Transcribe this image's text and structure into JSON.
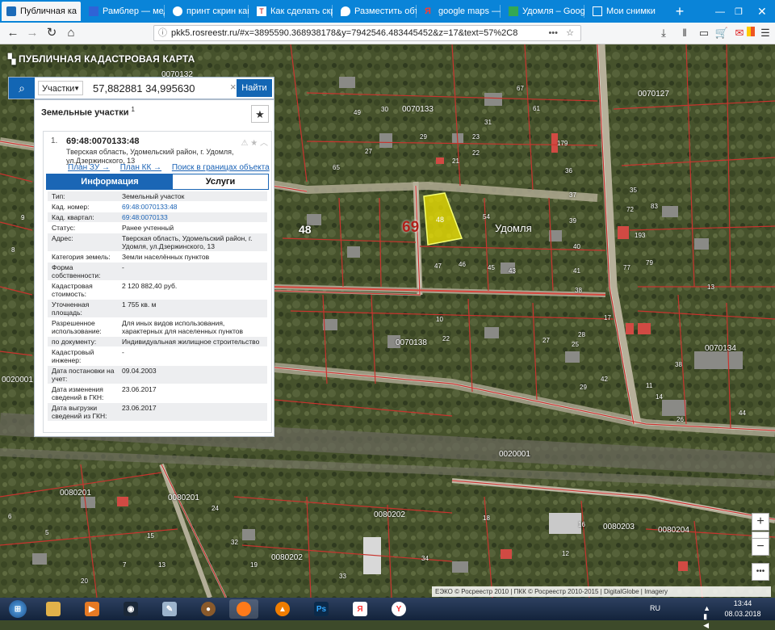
{
  "browser": {
    "tabs": [
      {
        "title": "Публичная ка",
        "active": true,
        "icon": "rosreestr-icon"
      },
      {
        "title": "Рамблер — меди",
        "icon": "rambler-icon"
      },
      {
        "title": "принт скрин как",
        "icon": "print-icon"
      },
      {
        "title": "Как сделать скри",
        "icon": "article-icon"
      },
      {
        "title": "Разместить объя",
        "icon": "map-pin-icon"
      },
      {
        "title": "google maps — Я",
        "icon": "yandex-icon"
      },
      {
        "title": "Удомля – Google",
        "icon": "google-maps-icon"
      },
      {
        "title": "Мои снимки",
        "icon": "screenshots-icon"
      }
    ],
    "url": "pkk5.rosreestr.ru/#x=3895590.368938178&y=7942546.483445452&z=17&text=57%2C8"
  },
  "app": {
    "brand": "ПУБЛИЧНАЯ КАДАСТРОВАЯ КАРТА"
  },
  "search": {
    "type_label": "Участки",
    "query": "57,882881 34,995630",
    "button": "Найти"
  },
  "panel": {
    "title": "Земельные участки",
    "title_sup": "1",
    "item_number": "1.",
    "cad_number": "69:48:0070133:48",
    "address": "Тверская область, Удомельский район, г. Удомля, ул.Дзержинского, 13",
    "links": [
      "План ЗУ →",
      "План КК →",
      "Поиск в границах объекта →"
    ],
    "tabs": [
      "Информация",
      "Услуги"
    ],
    "rows": [
      {
        "k": "Тип:",
        "v": "Земельный участок"
      },
      {
        "k": "Кад. номер:",
        "v": "69:48:0070133:48"
      },
      {
        "k": "Кад. квартал:",
        "v": "69:48:0070133"
      },
      {
        "k": "Статус:",
        "v": "Ранее учтенный"
      },
      {
        "k": "Адрес:",
        "v": "Тверская область, Удомельский район, г. Удомля, ул.Дзержинского, 13"
      },
      {
        "k": "Категория земель:",
        "v": "Земли населённых пунктов"
      },
      {
        "k": "Форма собственности:",
        "v": "-"
      },
      {
        "k": "Кадастровая стоимость:",
        "v": "2 120 882,40 руб."
      },
      {
        "k": "Уточненная площадь:",
        "v": "1 755 кв. м"
      },
      {
        "k": "Разрешенное использование:",
        "v": "Для иных видов использования, характерных для населенных пунктов"
      },
      {
        "k": "по документу:",
        "v": "Индивидуальная жилищное строительство"
      },
      {
        "k": "Кадастровый инженер:",
        "v": "-"
      },
      {
        "k": "Дата постановки на учет:",
        "v": "09.04.2003"
      },
      {
        "k": "Дата изменения сведений в ГКН:",
        "v": "23.06.2017"
      },
      {
        "k": "Дата выгрузки сведений из ГКН:",
        "v": "23.06.2017"
      }
    ]
  },
  "map": {
    "city_label": "Удомля",
    "district_number": "69",
    "quarter_48": "48",
    "parcel_label": "48",
    "quarters": [
      "0070132",
      "0070133",
      "0070127",
      "0070134",
      "0070138",
      "0020001",
      "0080201",
      "0080202",
      "0080203",
      "0080204",
      "0020001",
      "0080202",
      "0080201"
    ],
    "parcel_numbers": [
      "67",
      "61",
      "31",
      "23",
      "22",
      "21",
      "27",
      "29",
      "30",
      "65",
      "49",
      "179",
      "36",
      "37",
      "39",
      "40",
      "41",
      "38",
      "54",
      "47",
      "46",
      "45",
      "43",
      "72",
      "83",
      "79",
      "193",
      "77",
      "10",
      "22",
      "27",
      "25",
      "28",
      "14",
      "38",
      "13",
      "16",
      "34",
      "18",
      "12",
      "26",
      "15",
      "13",
      "24",
      "32",
      "11",
      "29",
      "17",
      "8",
      "9",
      "6",
      "5",
      "7",
      "20",
      "19",
      "33",
      "35",
      "44",
      "42"
    ],
    "attribution": "ЕЭКО © Росреестр 2010 | ПКК © Росреестр 2010-2015 | DigitalGlobe | Imagery"
  },
  "colors": {
    "accent": "#1366b4",
    "boundary": "#c8342e",
    "highlight": "#f2e600"
  },
  "taskbar": {
    "items": [
      "start-icon",
      "explorer-icon",
      "media-icon",
      "steam-icon",
      "tool-icon",
      "disc-icon",
      "firefox-icon",
      "avast-icon",
      "photoshop-icon",
      "yandex-icon",
      "yandex-browser-icon"
    ],
    "lang": "RU",
    "time": "13:44",
    "date": "08.03.2018"
  }
}
